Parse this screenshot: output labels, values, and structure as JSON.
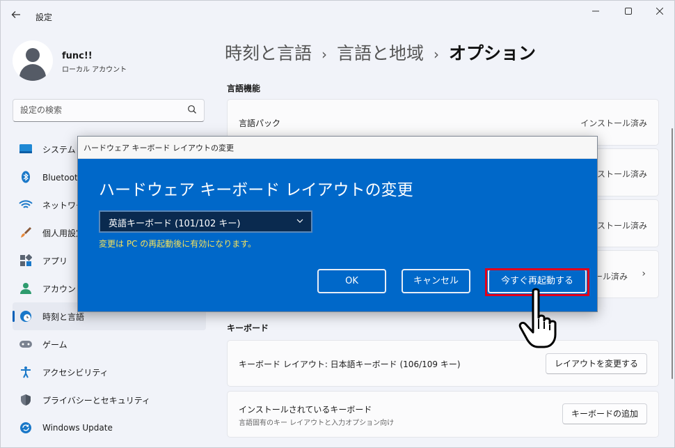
{
  "window": {
    "title": "設定",
    "back_icon": "back-arrow-icon",
    "controls": [
      "minimize-icon",
      "maximize-icon",
      "close-icon"
    ]
  },
  "user": {
    "name": "func!!",
    "account_type": "ローカル アカウント"
  },
  "search": {
    "placeholder": "設定の検索"
  },
  "sidebar": {
    "items": [
      {
        "label": "システム",
        "icon": "system-icon",
        "active": false
      },
      {
        "label": "Bluetooth とデバイス",
        "icon": "bluetooth-icon",
        "active": false
      },
      {
        "label": "ネットワークとインターネット",
        "icon": "wifi-icon",
        "active": false
      },
      {
        "label": "個人用設定",
        "icon": "brush-icon",
        "active": false
      },
      {
        "label": "アプリ",
        "icon": "apps-icon",
        "active": false
      },
      {
        "label": "アカウント",
        "icon": "account-icon",
        "active": false
      },
      {
        "label": "時刻と言語",
        "icon": "time-language-icon",
        "active": true
      },
      {
        "label": "ゲーム",
        "icon": "gamepad-icon",
        "active": false
      },
      {
        "label": "アクセシビリティ",
        "icon": "accessibility-icon",
        "active": false
      },
      {
        "label": "プライバシーとセキュリティ",
        "icon": "shield-icon",
        "active": false
      },
      {
        "label": "Windows Update",
        "icon": "update-icon",
        "active": false
      }
    ]
  },
  "main": {
    "breadcrumb": [
      "時刻と言語",
      "言語と地域",
      "オプション"
    ],
    "language_features": {
      "section_title": "言語機能",
      "rows": [
        {
          "label": "言語パック",
          "status": "インストール済み"
        },
        {
          "label": "",
          "status": "インストール済み"
        },
        {
          "label": "",
          "status": "インストール済み"
        },
        {
          "label": "",
          "status": "インストール済み"
        }
      ]
    },
    "keyboard": {
      "section_title": "キーボード",
      "layout_label": "キーボード レイアウト: 日本語キーボード (106/109 キー)",
      "change_layout_button": "レイアウトを変更する",
      "installed_label": "インストールされているキーボード",
      "installed_sub": "言語固有のキー レイアウトと入力オプション向け",
      "add_keyboard_button": "キーボードの追加"
    }
  },
  "dialog": {
    "window_title": "ハードウェア キーボード レイアウトの変更",
    "heading": "ハードウェア キーボード レイアウトの変更",
    "selected_layout": "英語キーボード (101/102 キー)",
    "note": "変更は PC の再起動後に有効になります。",
    "ok_button": "OK",
    "cancel_button": "キャンセル",
    "restart_button": "今すぐ再起動する"
  },
  "colors": {
    "accent": "#005fb8",
    "dialog_bg": "#0068c9",
    "note_text": "#f5e15c",
    "highlight": "#e3001b"
  }
}
